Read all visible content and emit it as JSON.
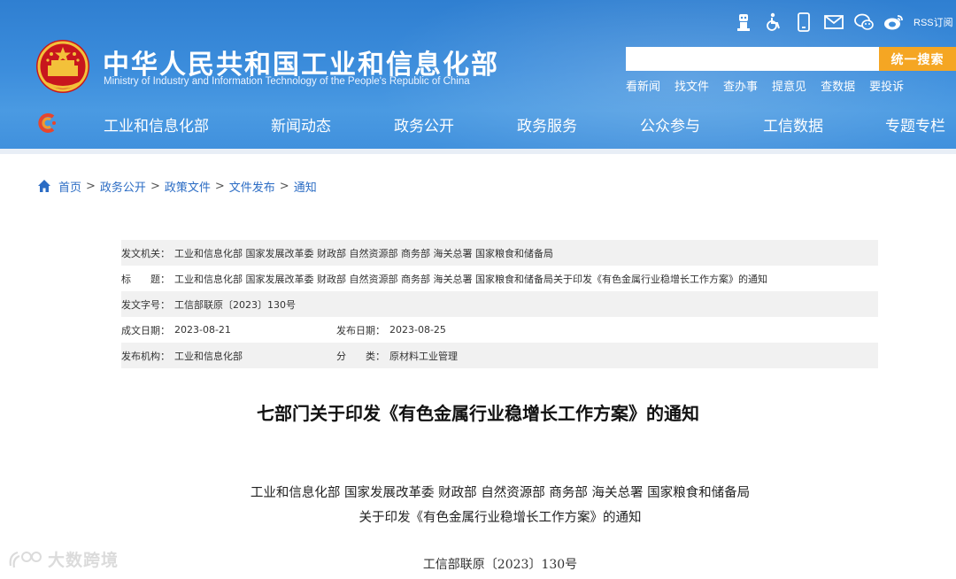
{
  "header": {
    "site_title_cn": "中华人民共和国工业和信息化部",
    "site_title_en": "Ministry of Industry and Information Technology of the People's Republic of China",
    "rss_label": "RSS订阅",
    "search": {
      "placeholder": "",
      "button_label": "统一搜索"
    },
    "quick_links": [
      "看新闻",
      "找文件",
      "查办事",
      "提意见",
      "查数据",
      "要投诉"
    ],
    "nav_items": [
      "工业和信息化部",
      "新闻动态",
      "政务公开",
      "政务服务",
      "公众参与",
      "工信数据",
      "专题专栏"
    ],
    "colors": {
      "header_blue": "#3c8ddc",
      "search_orange": "#f5a623"
    },
    "icons": [
      "accessibility-robot-icon",
      "wheelchair-icon",
      "mobile-phone-icon",
      "mail-icon",
      "wechat-icon",
      "weibo-icon"
    ]
  },
  "breadcrumb": {
    "items": [
      "首页",
      "政务公开",
      "政策文件",
      "文件发布",
      "通知"
    ],
    "separator": ">"
  },
  "meta": {
    "issuer_label": "发文机关：",
    "issuer": "工业和信息化部 国家发展改革委 财政部 自然资源部 商务部 海关总署 国家粮食和储备局",
    "title_label": "标　　题：",
    "title": "工业和信息化部 国家发展改革委 财政部 自然资源部 商务部 海关总署 国家粮食和储备局关于印发《有色金属行业稳增长工作方案》的通知",
    "doc_no_label": "发文字号：",
    "doc_no": "工信部联原〔2023〕130号",
    "created_label": "成文日期：",
    "created": "2023-08-21",
    "published_label": "发布日期：",
    "published": "2023-08-25",
    "org_label": "发布机构：",
    "org": "工业和信息化部",
    "category_label": "分　　类：",
    "category": "原材料工业管理"
  },
  "article": {
    "title": "七部门关于印发《有色金属行业稳增长工作方案》的通知",
    "line1": "工业和信息化部 国家发展改革委 财政部 自然资源部 商务部 海关总署 国家粮食和储备局",
    "line2": "关于印发《有色金属行业稳增长工作方案》的通知",
    "line3": "工信部联原〔2023〕130号"
  },
  "watermark": {
    "text": "大数跨境"
  }
}
